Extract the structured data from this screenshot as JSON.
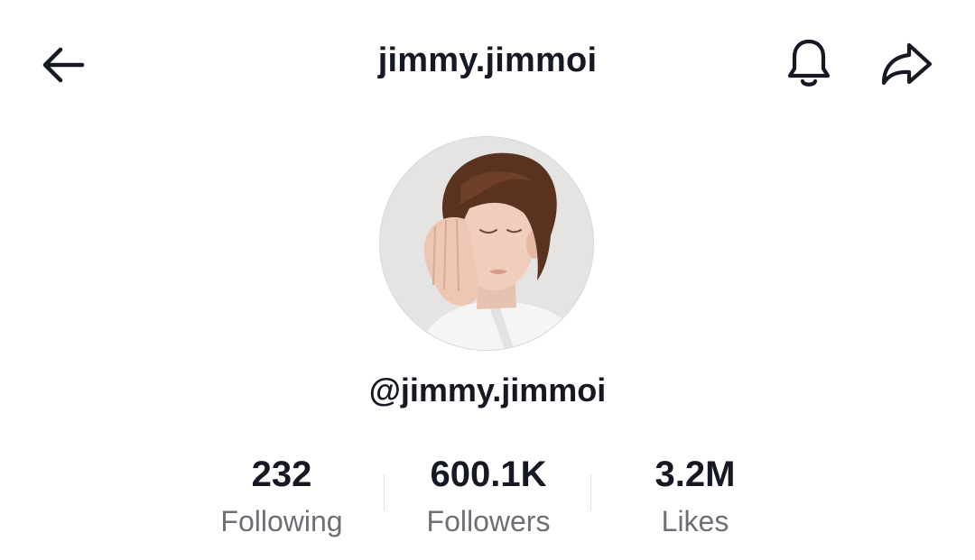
{
  "header": {
    "title": "jimmy.jimmoi",
    "back_icon": "arrow-left-icon",
    "bell_icon": "bell-icon",
    "share_icon": "share-arrow-icon"
  },
  "profile": {
    "handle": "@jimmy.jimmoi"
  },
  "stats": [
    {
      "value": "232",
      "label": "Following"
    },
    {
      "value": "600.1K",
      "label": "Followers"
    },
    {
      "value": "3.2M",
      "label": "Likes"
    }
  ],
  "colors": {
    "text_primary": "#161823",
    "text_secondary": "#6e6f76",
    "divider": "#e3e3e4"
  }
}
